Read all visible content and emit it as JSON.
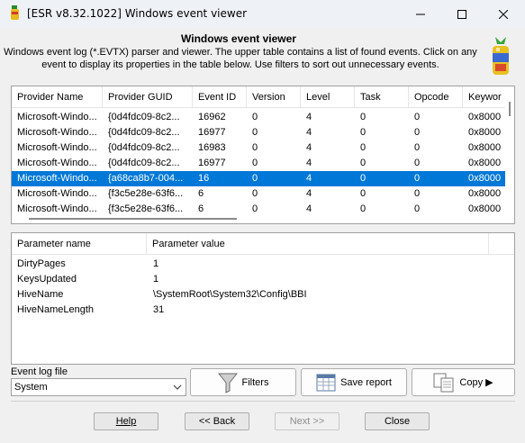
{
  "window": {
    "title": "[ESR v8.32.1022]  Windows event viewer"
  },
  "header": {
    "title": "Windows event viewer",
    "description": "Windows event log (*.EVTX) parser and viewer. The upper table contains a list of found events. Click on any event to display its properties in the table below. Use filters to sort out unnecessary events."
  },
  "events_table": {
    "columns": [
      "Provider Name",
      "Provider GUID",
      "Event ID",
      "Version",
      "Level",
      "Task",
      "Opcode",
      "Keywor"
    ],
    "rows": [
      [
        "Microsoft-Windo...",
        "{0d4fdc09-8c2...",
        "16962",
        "0",
        "4",
        "0",
        "0",
        "0x8000"
      ],
      [
        "Microsoft-Windo...",
        "{0d4fdc09-8c2...",
        "16977",
        "0",
        "4",
        "0",
        "0",
        "0x8000"
      ],
      [
        "Microsoft-Windo...",
        "{0d4fdc09-8c2...",
        "16983",
        "0",
        "4",
        "0",
        "0",
        "0x8000"
      ],
      [
        "Microsoft-Windo...",
        "{0d4fdc09-8c2...",
        "16977",
        "0",
        "4",
        "0",
        "0",
        "0x8000"
      ],
      [
        "Microsoft-Windo...",
        "{a68ca8b7-004...",
        "16",
        "0",
        "4",
        "0",
        "0",
        "0x8000"
      ],
      [
        "Microsoft-Windo...",
        "{f3c5e28e-63f6...",
        "6",
        "0",
        "4",
        "0",
        "0",
        "0x8000"
      ],
      [
        "Microsoft-Windo...",
        "{f3c5e28e-63f6...",
        "6",
        "0",
        "4",
        "0",
        "0",
        "0x8000"
      ]
    ],
    "selected_row": 4
  },
  "params_table": {
    "columns": [
      "Parameter name",
      "Parameter value"
    ],
    "rows": [
      [
        "DirtyPages",
        "1"
      ],
      [
        "KeysUpdated",
        "1"
      ],
      [
        "HiveName",
        "\\SystemRoot\\System32\\Config\\BBI"
      ],
      [
        "HiveNameLength",
        "31"
      ]
    ]
  },
  "event_log": {
    "label": "Event log file",
    "selected": "System"
  },
  "buttons": {
    "filters": "Filters",
    "save_report": "Save report",
    "copy": "Copy ▶",
    "help": "Help",
    "back": "<< Back",
    "next": "Next >>",
    "close": "Close"
  },
  "colors": {
    "selection": "#0078d7",
    "background": "#f0f0f0"
  }
}
